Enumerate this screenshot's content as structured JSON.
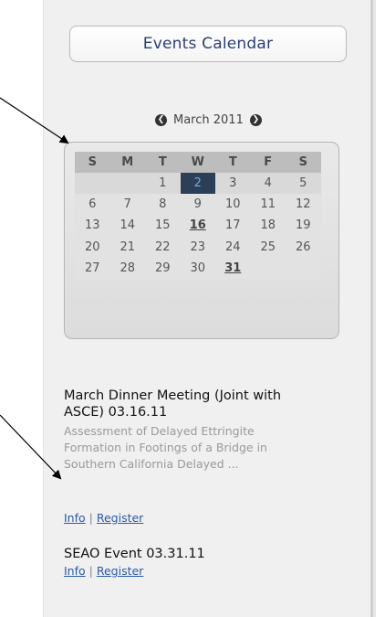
{
  "events_button": {
    "label": "Events Calendar"
  },
  "calendar": {
    "month_label": "March 2011",
    "prev_icon": "chevron-left-circle-icon",
    "next_icon": "chevron-right-circle-icon",
    "weekdays": [
      "S",
      "M",
      "T",
      "W",
      "T",
      "F",
      "S"
    ],
    "weeks": [
      [
        "",
        "",
        "1",
        "2",
        "3",
        "4",
        "5"
      ],
      [
        "6",
        "7",
        "8",
        "9",
        "10",
        "11",
        "12"
      ],
      [
        "13",
        "14",
        "15",
        "16",
        "17",
        "18",
        "19"
      ],
      [
        "20",
        "21",
        "22",
        "23",
        "24",
        "25",
        "26"
      ],
      [
        "27",
        "28",
        "29",
        "30",
        "31",
        "",
        ""
      ]
    ],
    "today": "2",
    "event_days": [
      "16",
      "31"
    ]
  },
  "events": [
    {
      "title_line1": "March Dinner Meeting (Joint with",
      "title_line2": "ASCE) 03.16.11",
      "desc_line1": "Assessment of Delayed Ettringite",
      "desc_line2": "Formation in Footings of a Bridge in",
      "desc_line3": "Southern California Delayed ...",
      "info_label": "Info",
      "separator": "|",
      "register_label": "Register"
    },
    {
      "title_line1": "SEAO Event 03.31.11",
      "info_label": "Info",
      "separator": "|",
      "register_label": "Register"
    }
  ],
  "annotation_color": "#000000"
}
